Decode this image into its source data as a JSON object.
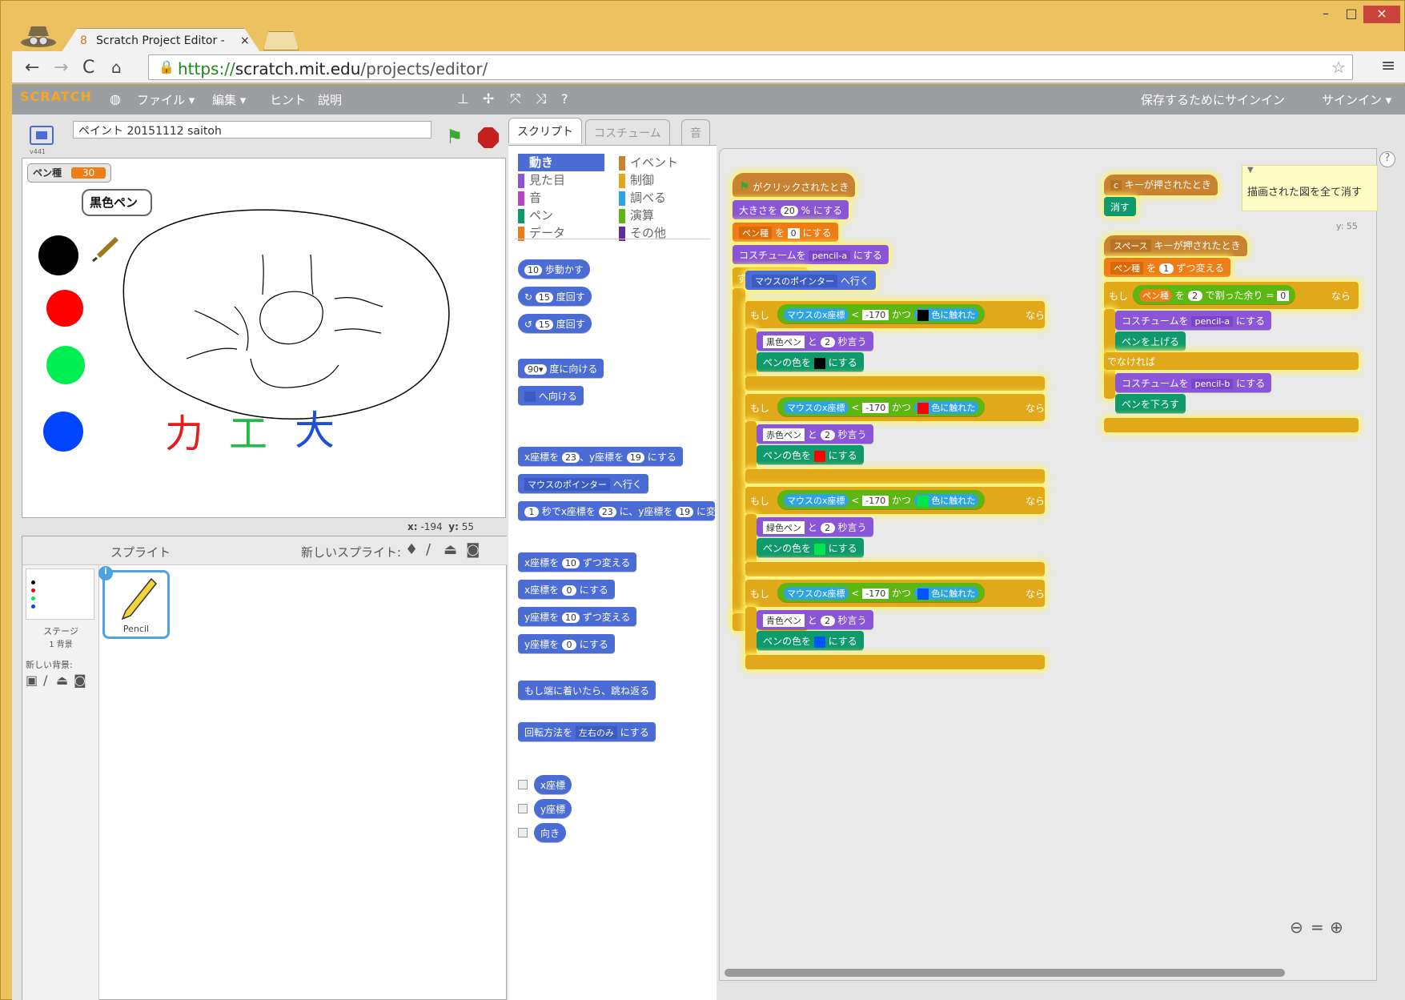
{
  "browser": {
    "tab_title": "Scratch Project Editor -",
    "tab_close": "×",
    "url_prefix": "https://",
    "url_host": "scratch.mit.edu",
    "url_path": "/projects/editor/",
    "win_min": "–",
    "win_max": "□",
    "win_close": "×"
  },
  "menubar": {
    "logo": "SCRATCH",
    "file": "ファイル ▾",
    "edit": "編集 ▾",
    "tips": "ヒント",
    "about": "説明",
    "save_signin": "保存するためにサインイン",
    "signin": "サインイン ▾"
  },
  "stage": {
    "project_title": "ペイント 20151112 saitoh",
    "version": "v441",
    "var_label": "ペン種",
    "var_value": "30",
    "speech": "黒色ペン",
    "x_label": "x:",
    "x_val": "-194",
    "y_label": "y:",
    "y_val": "55",
    "drawn_text_red": "力",
    "drawn_text_green": "工",
    "drawn_text_blue": "大"
  },
  "sprites": {
    "header": "スプライト",
    "new_sprite": "新しいスプライト:",
    "stage_label": "ステージ",
    "stage_backdrops": "1 背景",
    "new_backdrop": "新しい背景:",
    "sprite_name": "Pencil"
  },
  "tabs": [
    "スクリプト",
    "コスチューム",
    "音"
  ],
  "categories": [
    {
      "label": "動き",
      "color": "#4a6cd4"
    },
    {
      "label": "イベント",
      "color": "#c88330"
    },
    {
      "label": "見た目",
      "color": "#8a55d7"
    },
    {
      "label": "制御",
      "color": "#e1a91a"
    },
    {
      "label": "音",
      "color": "#bb42c3"
    },
    {
      "label": "調べる",
      "color": "#2ca5e2"
    },
    {
      "label": "ペン",
      "color": "#0e9a6c"
    },
    {
      "label": "演算",
      "color": "#5cb712"
    },
    {
      "label": "データ",
      "color": "#ee7d16"
    },
    {
      "label": "その他",
      "color": "#632d99"
    }
  ],
  "palette": {
    "move": [
      "10",
      "歩動かす"
    ],
    "turn_r": [
      "15",
      "度回す"
    ],
    "turn_l": [
      "15",
      "度回す"
    ],
    "point_dir": [
      "90▾",
      "度に向ける"
    ],
    "point_towards": "へ向ける",
    "goto_xy": [
      "x座標を",
      "23",
      "、y座標を",
      "19",
      "にする"
    ],
    "goto_mouse": [
      "マウスのポインター",
      "へ行く"
    ],
    "glide": [
      "1",
      "秒でx座標を",
      "23",
      "に、y座標を",
      "19",
      "に変"
    ],
    "change_x": [
      "x座標を",
      "10",
      "ずつ変える"
    ],
    "set_x": [
      "x座標を",
      "0",
      "にする"
    ],
    "change_y": [
      "y座標を",
      "10",
      "ずつ変える"
    ],
    "set_y": [
      "y座標を",
      "0",
      "にする"
    ],
    "bounce": "もし端に着いたら、跳ね返る",
    "rotation": [
      "回転方法を",
      "左右のみ",
      "にする"
    ],
    "rep_x": "x座標",
    "rep_y": "y座標",
    "rep_dir": "向き"
  },
  "script1": {
    "hat": "がクリックされたとき",
    "size": [
      "大きさを",
      "20",
      "% にする"
    ],
    "setvar": [
      "ペン種",
      "を",
      "0",
      "にする"
    ],
    "costume": [
      "コスチュームを",
      "pencil-a",
      "にする"
    ],
    "forever": "ずっと",
    "goto": [
      "マウスのポインター",
      "へ行く"
    ],
    "if": "もし",
    "mousex": "マウスのx座標",
    "lt": "<",
    "val": "-170",
    "and": "かつ",
    "touching": "色に触れた",
    "then": "なら",
    "to": "と",
    "secs": "2",
    "say": "秒言う",
    "pencolor": "ペンの色を",
    "set": "にする",
    "branches": [
      {
        "say": "黒色ペン",
        "color": "#000000"
      },
      {
        "say": "赤色ペン",
        "color": "#ff0000"
      },
      {
        "say": "緑色ペン",
        "color": "#00e64d"
      },
      {
        "say": "青色ペン",
        "color": "#0055ff"
      }
    ]
  },
  "script2": {
    "key": "c",
    "hat": "キーが押されたとき",
    "clear": "消す",
    "comment": "描画された図を全て消す"
  },
  "script3": {
    "key": "スペース",
    "hat": "キーが押されたとき",
    "var": "ペン種",
    "wo": "を",
    "inc": "1",
    "change": "ずつ変える",
    "if": "もし",
    "mod_a": "ペン種",
    "mod_b": "を",
    "mod_c": "2",
    "mod_d": "で割った余り",
    "eq": "=",
    "zero": "0",
    "then": "なら",
    "costume_a": [
      "コスチュームを",
      "pencil-a",
      "にする"
    ],
    "penup": "ペンを上げる",
    "else": "でなければ",
    "costume_b": [
      "コスチュームを",
      "pencil-b",
      "にする"
    ],
    "pendown": "ペンを下ろす"
  },
  "scripts_area": {
    "y_readout": "y: 55"
  }
}
